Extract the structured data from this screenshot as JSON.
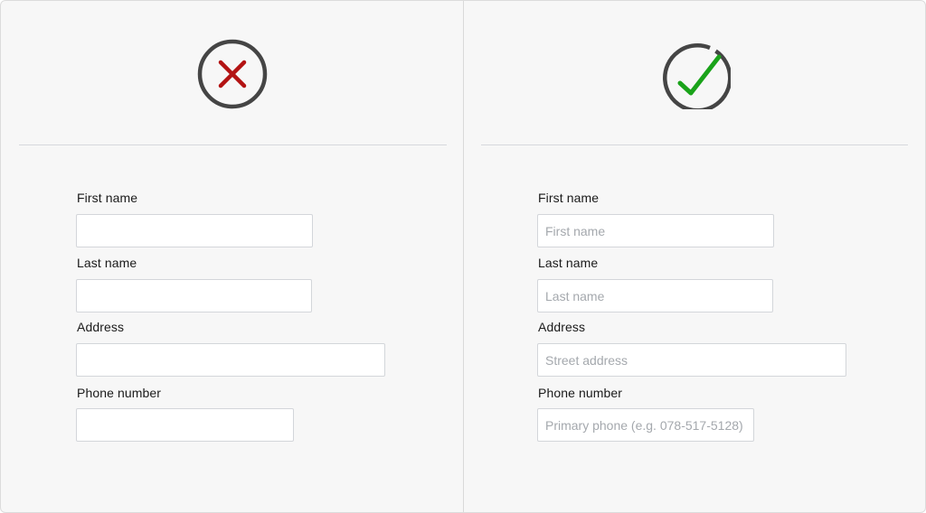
{
  "comparison": {
    "bad_example": {
      "status_icon": "x-circle-icon",
      "status_color": "#b31313",
      "fields": [
        {
          "label": "First name",
          "placeholder": ""
        },
        {
          "label": "Last name",
          "placeholder": ""
        },
        {
          "label": "Address",
          "placeholder": ""
        },
        {
          "label": "Phone number",
          "placeholder": ""
        }
      ]
    },
    "good_example": {
      "status_icon": "check-circle-icon",
      "status_color": "#1aa31a",
      "fields": [
        {
          "label": "First name",
          "placeholder": "First name"
        },
        {
          "label": "Last name",
          "placeholder": "Last name"
        },
        {
          "label": "Address",
          "placeholder": "Street address"
        },
        {
          "label": "Phone number",
          "placeholder": "Primary phone (e.g. 078-517-5128)"
        }
      ]
    },
    "icon_ring_color": "#454545"
  }
}
